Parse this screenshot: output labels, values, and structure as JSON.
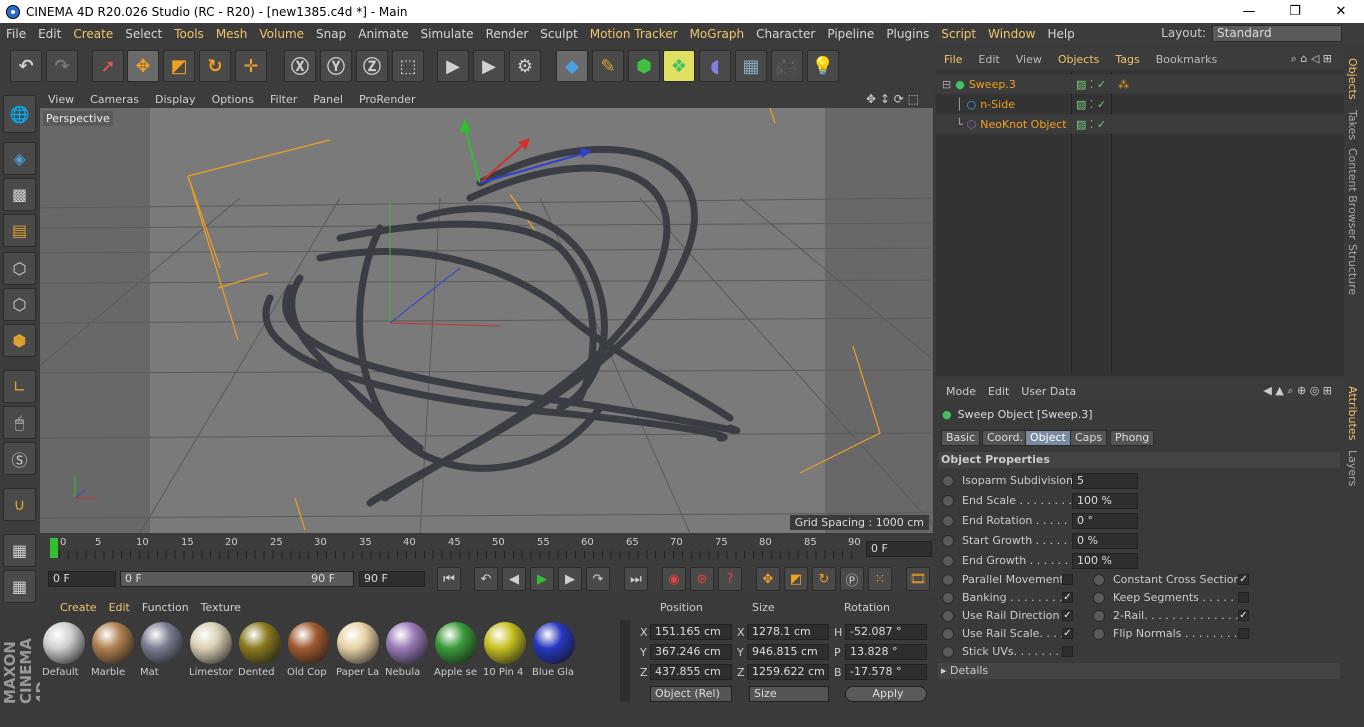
{
  "window": {
    "title": "CINEMA 4D R20.026 Studio (RC - R20) - [new1385.c4d *] - Main",
    "min": "—",
    "max": "❐",
    "close": "✕"
  },
  "menu": [
    {
      "label": "File"
    },
    {
      "label": "Edit"
    },
    {
      "label": "Create"
    },
    {
      "label": "Select"
    },
    {
      "label": "Tools"
    },
    {
      "label": "Mesh"
    },
    {
      "label": "Volume"
    },
    {
      "label": "Snap"
    },
    {
      "label": "Animate"
    },
    {
      "label": "Simulate"
    },
    {
      "label": "Render"
    },
    {
      "label": "Sculpt"
    },
    {
      "label": "Motion Tracker"
    },
    {
      "label": "MoGraph"
    },
    {
      "label": "Character"
    },
    {
      "label": "Pipeline"
    },
    {
      "label": "Plugins"
    },
    {
      "label": "Script"
    },
    {
      "label": "Window"
    },
    {
      "label": "Help"
    }
  ],
  "layout": {
    "label": "Layout:",
    "value": "Standard"
  },
  "viewport": {
    "menu": [
      "View",
      "Cameras",
      "Display",
      "Options",
      "Filter",
      "Panel",
      "ProRender"
    ],
    "camera": "Perspective",
    "grid_spacing": "Grid Spacing : 1000 cm"
  },
  "timeline": {
    "ticks": [
      "0",
      "5",
      "10",
      "15",
      "20",
      "25",
      "30",
      "35",
      "40",
      "45",
      "50",
      "55",
      "60",
      "65",
      "70",
      "75",
      "80",
      "85",
      "90"
    ],
    "current_frame": "0 F",
    "start": "0 F",
    "range_start": "0 F",
    "range_end": "90 F",
    "end": "90 F"
  },
  "materials": {
    "menu": [
      "Create",
      "Edit",
      "Function",
      "Texture"
    ],
    "items": [
      {
        "name": "Default",
        "color": "#cfcfcf"
      },
      {
        "name": "Marble",
        "color": "#b08050"
      },
      {
        "name": "Mat",
        "color": "#7a7f92"
      },
      {
        "name": "Limestone",
        "color": "#d8cfb4"
      },
      {
        "name": "Dented",
        "color": "#8a7a20"
      },
      {
        "name": "Old Cop",
        "color": "#a05a30"
      },
      {
        "name": "Paper La",
        "color": "#e8d2a8"
      },
      {
        "name": "Nebula",
        "color": "#9a7ab8"
      },
      {
        "name": "Apple se",
        "color": "#3a9a3a"
      },
      {
        "name": "10 Pin 4",
        "color": "#c8c020"
      },
      {
        "name": "Blue Gla",
        "color": "#2838c0"
      }
    ]
  },
  "coords": {
    "headers": {
      "position": "Position",
      "size": "Size",
      "rotation": "Rotation"
    },
    "rows": [
      {
        "axis": "X",
        "pos": "151.165 cm",
        "saxis": "X",
        "size": "1278.1 cm",
        "raxis": "H",
        "rot": "-52.087 °"
      },
      {
        "axis": "Y",
        "pos": "367.246 cm",
        "saxis": "Y",
        "size": "946.815 cm",
        "raxis": "P",
        "rot": "13.828 °"
      },
      {
        "axis": "Z",
        "pos": "437.855 cm",
        "saxis": "Z",
        "size": "1259.622 cm",
        "raxis": "B",
        "rot": "-17.578 °"
      }
    ],
    "mode": "Object (Rel)",
    "size_mode": "Size",
    "apply": "Apply"
  },
  "objects": {
    "menu": [
      "File",
      "Edit",
      "View",
      "Objects",
      "Tags",
      "Bookmarks"
    ],
    "tree": [
      {
        "name": "Sweep.3"
      },
      {
        "name": "n-Side"
      },
      {
        "name": "NeoKnot Object"
      }
    ]
  },
  "side_tabs": [
    "Objects",
    "Takes",
    "Content Browser",
    "Structure",
    "Attributes",
    "Layers"
  ],
  "attributes": {
    "menu": [
      "Mode",
      "Edit",
      "User Data"
    ],
    "object_title": "Sweep Object [Sweep.3]",
    "tabs": [
      "Basic",
      "Coord.",
      "Object",
      "Caps",
      "Phong"
    ],
    "section": "Object Properties",
    "fields": [
      {
        "label": "Isoparm Subdivision",
        "value": "5"
      },
      {
        "label": "End Scale . . . . . . . . .",
        "value": "100 %"
      },
      {
        "label": "End Rotation . . . . . .",
        "value": "0 °"
      },
      {
        "label": "Start Growth . . . . . .",
        "value": "0 %"
      },
      {
        "label": "End Growth . . . . . . .",
        "value": "100 %"
      }
    ],
    "checks_left": [
      {
        "label": "Parallel Movement",
        "checked": ""
      },
      {
        "label": "Banking . . . . . . . . .",
        "checked": "✓"
      },
      {
        "label": "Use Rail Direction",
        "checked": "✓"
      },
      {
        "label": "Use Rail Scale. . . .",
        "checked": "✓"
      },
      {
        "label": "Stick UVs. . . . . . . .",
        "checked": ""
      }
    ],
    "checks_right": [
      {
        "label": "Constant Cross Section",
        "checked": "✓"
      },
      {
        "label": "Keep Segments . . . . . .",
        "checked": ""
      },
      {
        "label": "2-Rail. . . . . . . . . . . . . .",
        "checked": "✓"
      },
      {
        "label": "Flip Normals . . . . . . . . .",
        "checked": ""
      }
    ],
    "details": "Details"
  },
  "brand": "MAXON CINEMA 4D"
}
